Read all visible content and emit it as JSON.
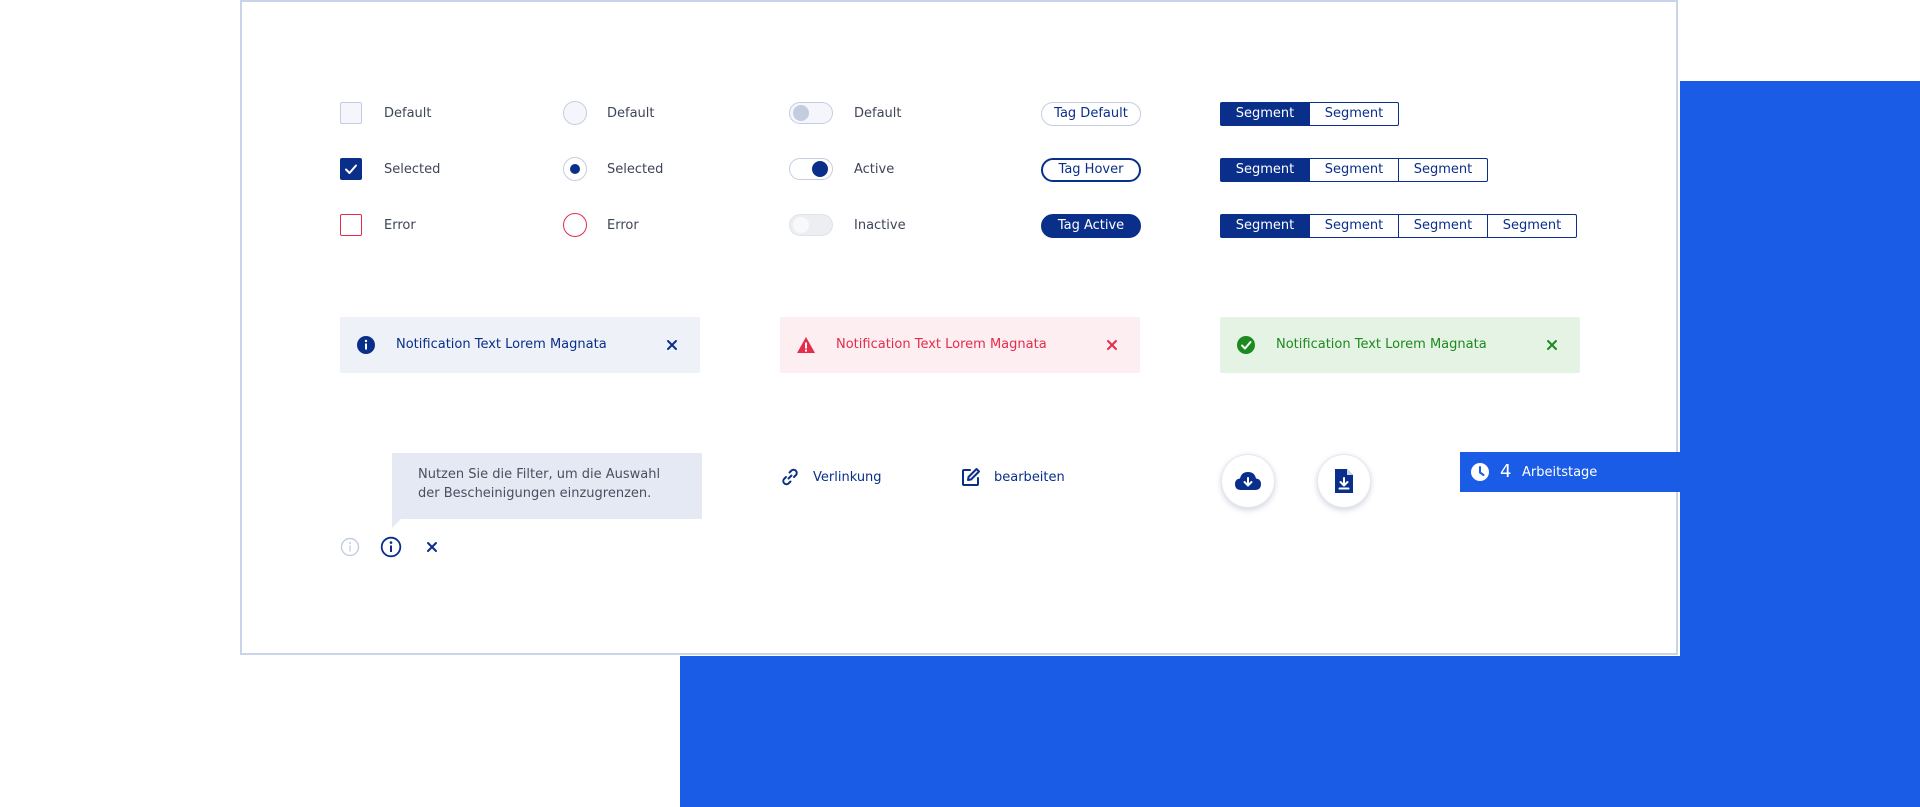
{
  "form_controls": {
    "checkbox": {
      "default": "Default",
      "selected": "Selected",
      "error": "Error"
    },
    "radio": {
      "default": "Default",
      "selected": "Selected",
      "error": "Error"
    },
    "toggle": {
      "default": "Default",
      "active": "Active",
      "inactive": "Inactive"
    }
  },
  "tags": {
    "default": "Tag Default",
    "hover": "Tag Hover",
    "active": "Tag Active"
  },
  "segments": {
    "row1": [
      "Segment",
      "Segment"
    ],
    "row2": [
      "Segment",
      "Segment",
      "Segment"
    ],
    "row3": [
      "Segment",
      "Segment",
      "Segment",
      "Segment"
    ]
  },
  "notifications": {
    "info": "Notification Text Lorem Magnata",
    "error": "Notification Text Lorem Magnata",
    "success": "Notification Text Lorem Magnata"
  },
  "tooltip": {
    "text": "Nutzen Sie die Filter, um die Auswahl der Bescheinigungen einzugrenzen."
  },
  "links": {
    "verlinkung": "Verlinkung",
    "bearbeiten": "bearbeiten"
  },
  "workdays": {
    "count": "4",
    "label": "Arbeitstage"
  },
  "colors": {
    "primary": "#0a2f8a",
    "accent_blue": "#1a5ce6",
    "error": "#e52c4a",
    "success": "#1c8a1f",
    "info_bg": "#eef1f7",
    "error_bg": "#fdeef1",
    "success_bg": "#e5f3e4"
  },
  "icons": {
    "info": "info-icon",
    "warning": "warning-icon",
    "success": "check-circle-icon",
    "close": "close-icon",
    "link": "link-icon",
    "edit": "edit-icon",
    "cloud_download": "cloud-download-icon",
    "file_download": "file-download-icon",
    "clock": "clock-icon"
  }
}
